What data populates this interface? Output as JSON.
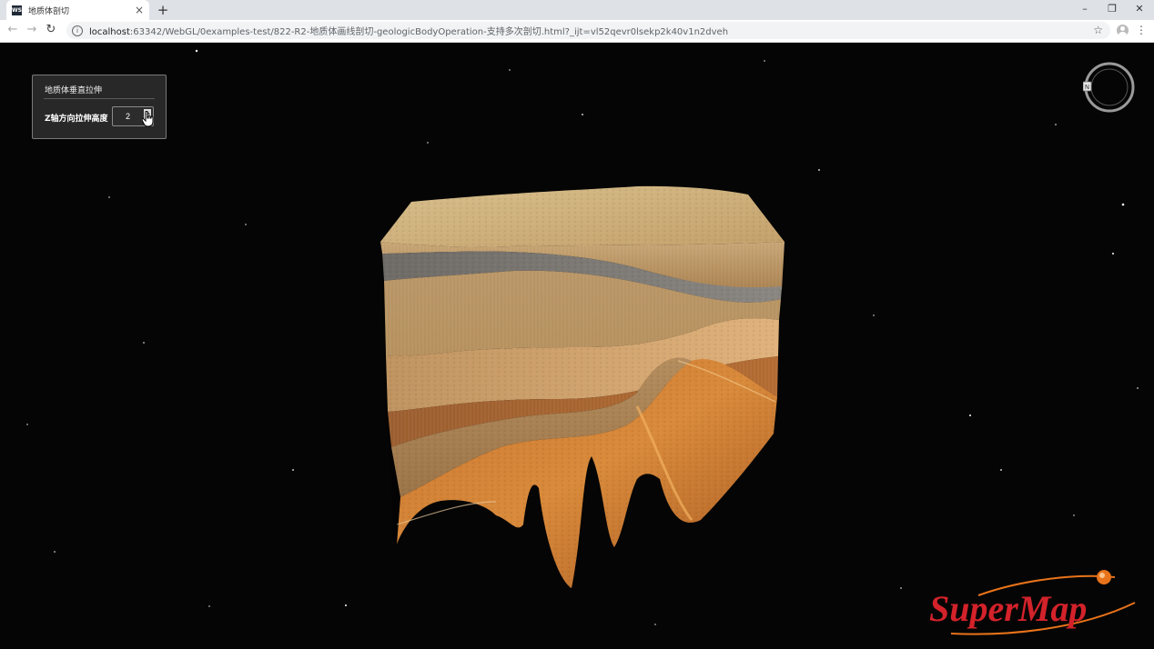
{
  "browser": {
    "tab_title": "地质体剖切",
    "favicon_label": "WS",
    "new_tab_symbol": "+",
    "tab_close_symbol": "×",
    "url_host": "localhost",
    "url_rest": ":63342/WebGL/0examples-test/822-R2-地质体画线剖切-geologicBodyOperation-支持多次剖切.html?_ijt=vl52qevr0lsekp2k40v1n2dveh"
  },
  "panel": {
    "title": "地质体垂直拉伸",
    "stretch_label": "Z轴方向拉伸高度",
    "stretch_value": "2"
  },
  "compass": {
    "north_label": "N"
  },
  "logo": {
    "text": "SuperMap",
    "accent_color": "#e8731a",
    "text_color": "#d3222a"
  }
}
